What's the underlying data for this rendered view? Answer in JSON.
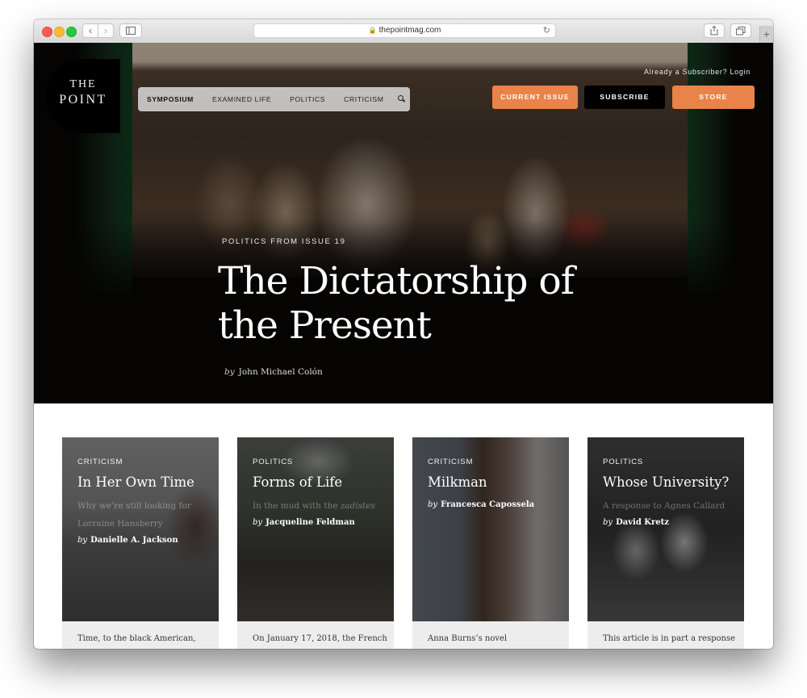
{
  "browser": {
    "url": "thepointmag.com",
    "icons": {
      "back": "chevron-left-icon",
      "forward": "chevron-right-icon",
      "sidebar": "sidebar-icon",
      "lock": "lock-icon",
      "reload": "reload-icon",
      "share": "share-icon",
      "tabs": "tabs-icon",
      "new_tab": "plus-icon"
    }
  },
  "site": {
    "logo": {
      "line1": "THE",
      "line2": "POINT"
    },
    "nav": [
      {
        "label": "SYMPOSIUM",
        "active": true
      },
      {
        "label": "EXAMINED LIFE",
        "active": false
      },
      {
        "label": "POLITICS",
        "active": false
      },
      {
        "label": "CRITICISM",
        "active": false
      }
    ],
    "login_text": "Already a Subscriber? Login",
    "buttons": {
      "current_issue": "CURRENT ISSUE",
      "subscribe": "SUBSCRIBE",
      "store": "STORE"
    },
    "accent_color": "#e8834a"
  },
  "hero": {
    "kicker": "POLITICS FROM ISSUE 19",
    "title": "The Dictatorship of the Present",
    "by": "by",
    "author": "John Michael Colón"
  },
  "cards": [
    {
      "kicker": "CRITICISM",
      "title": "In Her Own Time",
      "subtitle_line1": "Why we’re still looking for",
      "subtitle_line2": "Lorraine Hansberry",
      "by": "by",
      "author": "Danielle A. Jackson",
      "excerpt": "Time, to the black American,"
    },
    {
      "kicker": "POLITICS",
      "title": "Forms of Life",
      "subtitle_prefix": "In the mud with the ",
      "subtitle_italic": "zadistes",
      "by": "by",
      "author": "Jacqueline Feldman",
      "excerpt": "On January 17, 2018, the French"
    },
    {
      "kicker": "CRITICISM",
      "title": "Milkman",
      "by": "by",
      "author": "Francesca Capossela",
      "excerpt": "Anna Burns’s novel"
    },
    {
      "kicker": "POLITICS",
      "title": "Whose University?",
      "subtitle_line1": "A response to Agnes Callard",
      "by": "by",
      "author": "David Kretz",
      "excerpt": "This article is in part a response"
    }
  ]
}
